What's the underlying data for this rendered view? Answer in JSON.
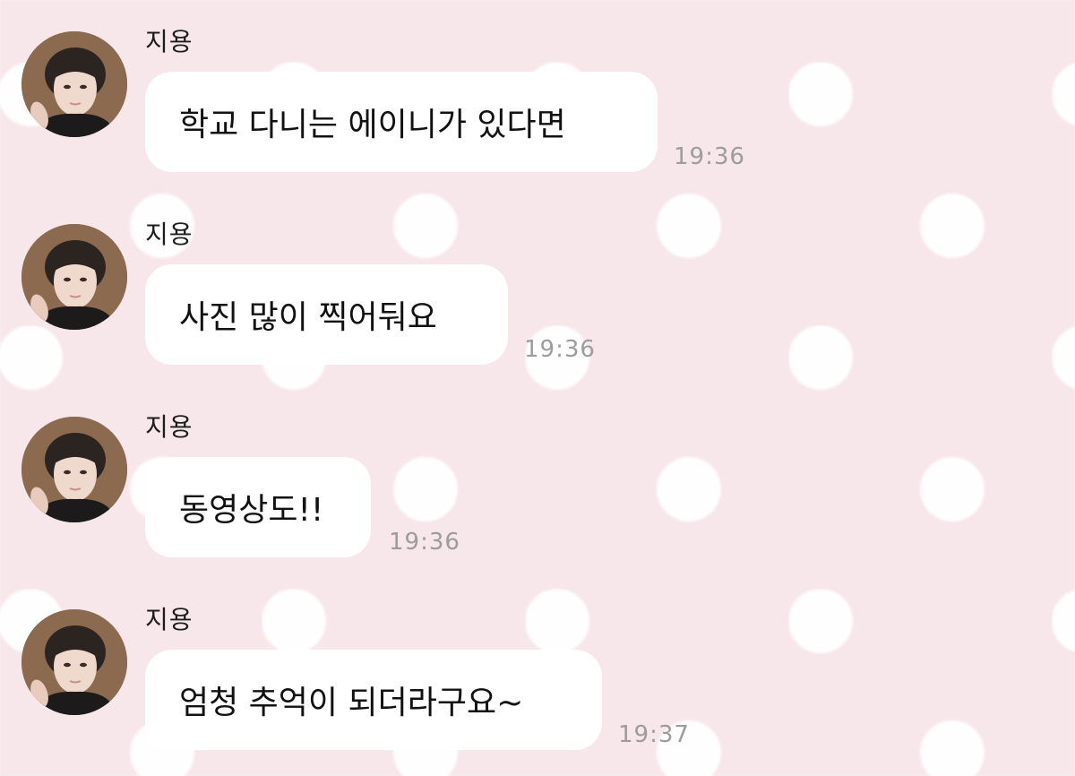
{
  "colors": {
    "background": "#f7e6ea",
    "polka_dot": "#ffffff",
    "bubble": "#ffffff",
    "sender_text": "#1d1d1d",
    "message_text": "#111111",
    "timestamp_text": "#9c9c9c"
  },
  "messages": [
    {
      "sender": "지용",
      "text": "학교 다니는 에이니가 있다면",
      "time": "19:36",
      "avatar_icon": "profile-photo-icon"
    },
    {
      "sender": "지용",
      "text": "사진 많이 찍어둬요",
      "time": "19:36",
      "avatar_icon": "profile-photo-icon"
    },
    {
      "sender": "지용",
      "text": "동영상도!!",
      "time": "19:36",
      "avatar_icon": "profile-photo-icon"
    },
    {
      "sender": "지용",
      "text": "엄청 추억이 되더라구요~",
      "time": "19:37",
      "avatar_icon": "profile-photo-icon"
    }
  ]
}
